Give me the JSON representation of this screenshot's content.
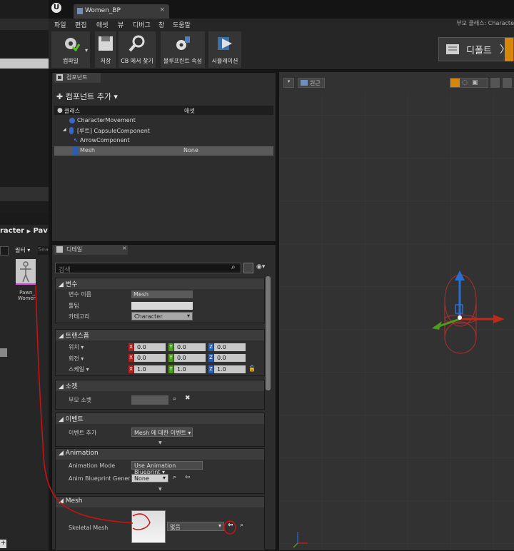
{
  "window": {
    "tab_title": "Women_BP",
    "logo": "U",
    "parent_class_label": "부모 클래스: Characte"
  },
  "menu": [
    "파일",
    "편집",
    "애셋",
    "뷰",
    "디버그",
    "창",
    "도움말"
  ],
  "toolbar": {
    "compile": "컴파일",
    "save": "저장",
    "find_in_cb": "CB 에서 찾기",
    "bp_props": "블루프린트 속성",
    "simulate": "시뮬레이션",
    "defaults": "디폴트"
  },
  "left_panel": {
    "breadcrumb_char": "racter",
    "breadcrumb_arrow": "▶",
    "breadcrumb_pawn": "Pav",
    "filter": "필터",
    "search_stub": "Sea",
    "asset_name": "Pawn_\nWomen"
  },
  "components": {
    "tab": "컴포넌트",
    "add": "컴포넌트 추가",
    "header_class": "클래스",
    "header_asset": "애셋",
    "items": [
      {
        "name": "CharacterMovement",
        "asset": ""
      },
      {
        "name": "[루트] CapsuleComponent",
        "asset": ""
      },
      {
        "name": "ArrowComponent",
        "asset": ""
      },
      {
        "name": "Mesh",
        "asset": "None"
      }
    ]
  },
  "details": {
    "tab": "디테일",
    "search_placeholder": "검색",
    "variable": {
      "title": "변수",
      "name_label": "변수 이름",
      "name_value": "Mesh",
      "tooltip_label": "툴팁",
      "tooltip_value": "",
      "category_label": "카테고리",
      "category_value": "Character"
    },
    "transform": {
      "title": "트랜스폼",
      "location_label": "위치",
      "rotation_label": "회전",
      "scale_label": "스케일",
      "location": [
        "0.0",
        "0.0",
        "0.0"
      ],
      "rotation": [
        "0.0",
        "0.0",
        "0.0"
      ],
      "scale": [
        "1.0",
        "1.0",
        "1.0"
      ],
      "axes": [
        "X",
        "Y",
        "Z"
      ]
    },
    "socket": {
      "title": "소켓",
      "parent_socket_label": "부모 소켓"
    },
    "events": {
      "title": "이벤트",
      "add_event_label": "이벤트 추가",
      "add_event_value": "Mesh 에 대한 이벤트"
    },
    "animation": {
      "title": "Animation",
      "mode_label": "Animation Mode",
      "mode_value": "Use Animation Blueprint",
      "class_label": "Anim Blueprint Generate",
      "class_value": "None"
    },
    "mesh": {
      "title": "Mesh",
      "skeletal_label": "Skeletal Mesh",
      "skeletal_value": "없음"
    }
  },
  "viewport": {
    "view_btn": "원근"
  },
  "colors": {
    "accent_orange": "#d4870a",
    "annotation_red": "#d01010",
    "axis_x": "#b32020",
    "axis_y": "#4f9a1e",
    "axis_z": "#2a5fb5"
  }
}
